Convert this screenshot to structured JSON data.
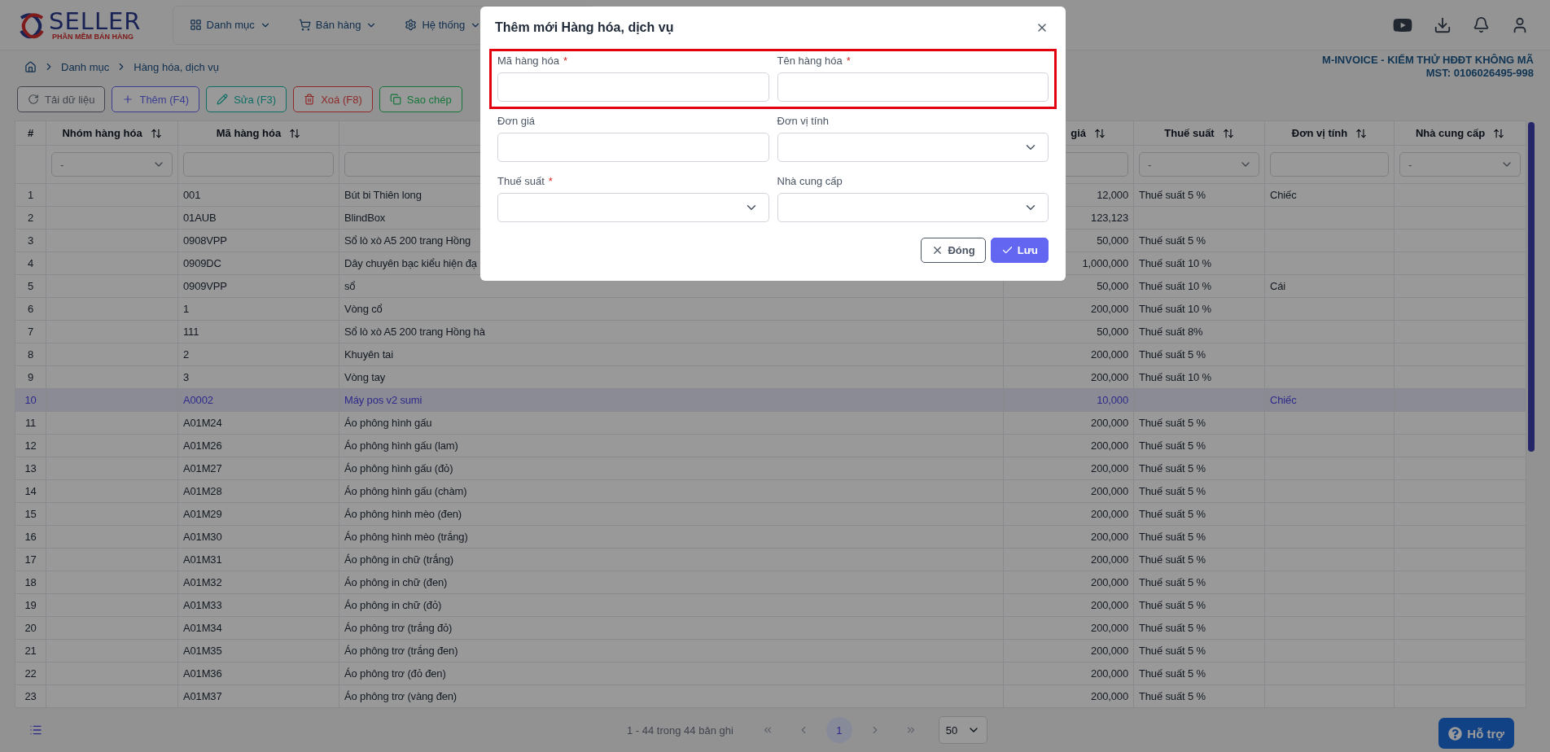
{
  "header": {
    "logo": {
      "title": "SELLER",
      "subtitle": "PHẦN MỀM BÁN HÀNG"
    },
    "nav": [
      {
        "label": "Danh mục",
        "kind": "catalog"
      },
      {
        "label": "Bán hàng",
        "kind": "sales"
      },
      {
        "label": "Hệ thống",
        "kind": "system"
      }
    ]
  },
  "breadcrumb": [
    "Danh mục",
    "Hàng hóa, dịch vụ"
  ],
  "company": [
    "M-INVOICE - KIỂM THỬ HĐĐT KHÔNG MÃ",
    "MST: 0106026495-998"
  ],
  "toolbar": [
    {
      "label": "Tải dữ liệu",
      "kind": "reload",
      "color": "#40444d"
    },
    {
      "label": "Thêm (F4)",
      "kind": "add",
      "color": "#3b3d91"
    },
    {
      "label": "Sửa (F3)",
      "kind": "edit",
      "color": "#0c6e64"
    },
    {
      "label": "Xoá (F8)",
      "kind": "delete",
      "color": "#8f2929"
    },
    {
      "label": "Sao chép",
      "kind": "copy",
      "color": "#147638"
    }
  ],
  "table": {
    "columns": [
      {
        "label": "#",
        "sortable": false,
        "kind": "index"
      },
      {
        "label": "Nhóm hàng hóa",
        "sortable": true,
        "kind": "text",
        "filter": {
          "kind": "select",
          "value": "-"
        }
      },
      {
        "label": "Mã hàng hóa",
        "sortable": true,
        "kind": "text",
        "filter": {
          "kind": "input"
        }
      },
      {
        "sortable": false,
        "kind": "text",
        "filter": {
          "kind": "input"
        }
      },
      {
        "label": "giá",
        "sortable": true,
        "kind": "number",
        "filter": {
          "kind": "input"
        }
      },
      {
        "label": "Thuế suất",
        "sortable": true,
        "kind": "text",
        "filter": {
          "kind": "select",
          "value": "-"
        }
      },
      {
        "label": "Đơn vị tính",
        "sortable": true,
        "kind": "text",
        "filter": {
          "kind": "input"
        }
      },
      {
        "label": "Nhà cung cấp",
        "sortable": true,
        "kind": "text",
        "filter": {
          "kind": "select",
          "value": "-"
        }
      }
    ],
    "rows": [
      {
        "no": "1",
        "code": "001",
        "name": "Bút bi Thiên long",
        "price": "12,000",
        "tax": "Thuế suất 5 %",
        "unit": "Chiếc",
        "selected": false
      },
      {
        "no": "2",
        "code": "01AUB",
        "name": "BlindBox",
        "price": "123,123",
        "selected": false
      },
      {
        "no": "3",
        "code": "0908VPP",
        "name": "Sổ lò xò A5 200 trang Hồng",
        "price": "50,000",
        "tax": "Thuế suất 5 %",
        "selected": false
      },
      {
        "no": "4",
        "code": "0909DC",
        "name": "Dây chuyên bạc kiểu hiện đạ",
        "price": "1,000,000",
        "tax": "Thuế suất 10 %",
        "selected": false
      },
      {
        "no": "5",
        "code": "0909VPP",
        "name": "sổ",
        "price": "50,000",
        "tax": "Thuế suất 10 %",
        "unit": "Cái",
        "selected": false
      },
      {
        "no": "6",
        "code": "1",
        "name": "Vòng cổ",
        "price": "200,000",
        "tax": "Thuế suất 10 %",
        "selected": false
      },
      {
        "no": "7",
        "code": "111",
        "name": "Sổ lò xò A5 200 trang Hồng hà",
        "price": "50,000",
        "tax": "Thuế suất 8%",
        "selected": false
      },
      {
        "no": "8",
        "code": "2",
        "name": "Khuyên tai",
        "price": "200,000",
        "tax": "Thuế suất 5 %",
        "selected": false
      },
      {
        "no": "9",
        "code": "3",
        "name": "Vòng tay",
        "price": "200,000",
        "tax": "Thuế suất 10 %",
        "selected": false
      },
      {
        "no": "10",
        "code": "A0002",
        "name": "Máy pos v2 sumi",
        "price": "10,000",
        "unit": "Chiếc",
        "selected": true
      },
      {
        "no": "11",
        "code": "A01M24",
        "name": "Áo phông hình gấu",
        "price": "200,000",
        "tax": "Thuế suất 5 %",
        "selected": false
      },
      {
        "no": "12",
        "code": "A01M26",
        "name": "Áo phông hình gấu (lam)",
        "price": "200,000",
        "tax": "Thuế suất 5 %",
        "selected": false
      },
      {
        "no": "13",
        "code": "A01M27",
        "name": "Áo phông hình gấu (đỏ)",
        "price": "200,000",
        "tax": "Thuế suất 5 %",
        "selected": false
      },
      {
        "no": "14",
        "code": "A01M28",
        "name": "Áo phông hình gấu (chàm)",
        "price": "200,000",
        "tax": "Thuế suất 5 %",
        "selected": false
      },
      {
        "no": "15",
        "code": "A01M29",
        "name": "Áo phông hình mèo (đen)",
        "price": "200,000",
        "tax": "Thuế suất 5 %",
        "selected": false
      },
      {
        "no": "16",
        "code": "A01M30",
        "name": "Áo phông hình mèo (trắng)",
        "price": "200,000",
        "tax": "Thuế suất 5 %",
        "selected": false
      },
      {
        "no": "17",
        "code": "A01M31",
        "name": "Áo phông in chữ (trắng)",
        "price": "200,000",
        "tax": "Thuế suất 5 %",
        "selected": false
      },
      {
        "no": "18",
        "code": "A01M32",
        "name": "Áo phông in chữ (đen)",
        "price": "200,000",
        "tax": "Thuế suất 5 %",
        "selected": false
      },
      {
        "no": "19",
        "code": "A01M33",
        "name": "Áo phông in chữ (đỏ)",
        "price": "200,000",
        "tax": "Thuế suất 5 %",
        "selected": false
      },
      {
        "no": "20",
        "code": "A01M34",
        "name": "Áo phông trơ (trắng đỏ)",
        "price": "200,000",
        "tax": "Thuế suất 5 %",
        "selected": false
      },
      {
        "no": "21",
        "code": "A01M35",
        "name": "Áo phông trơ (trắng đen)",
        "price": "200,000",
        "tax": "Thuế suất 5 %",
        "selected": false
      },
      {
        "no": "22",
        "code": "A01M36",
        "name": "Áo phông trơ (đỏ đen)",
        "price": "200,000",
        "tax": "Thuế suất 5 %",
        "selected": false
      },
      {
        "no": "23",
        "code": "A01M37",
        "name": "Áo phông trơ (vàng đen)",
        "price": "200,000",
        "tax": "Thuế suất 5 %",
        "selected": false
      }
    ]
  },
  "pagination": {
    "summary": "1 - 44 trong 44 bản ghi",
    "pages": [
      {
        "label": "1",
        "selected": true
      }
    ],
    "page_size": "50"
  },
  "help": {
    "label": "Hỗ trợ"
  },
  "modal": {
    "title": "Thêm mới Hàng hóa, dịch vụ",
    "rows": [
      {
        "highlighted": true,
        "fields": [
          {
            "label": "Mã hàng hóa",
            "required_mark": "*",
            "kind": "input"
          },
          {
            "label": "Tên hàng hóa",
            "required_mark": "*",
            "kind": "input"
          }
        ]
      },
      {
        "highlighted": false,
        "fields": [
          {
            "label": "Đơn giá",
            "kind": "input"
          },
          {
            "label": "Đơn vị tính",
            "kind": "select"
          }
        ]
      },
      {
        "highlighted": false,
        "fields": [
          {
            "label": "Thuế suất",
            "required_mark": "*",
            "kind": "select"
          },
          {
            "label": "Nhà cung cấp",
            "kind": "select"
          }
        ]
      }
    ],
    "buttons": [
      {
        "label": "Đóng",
        "kind": "secondary"
      },
      {
        "label": "Lưu",
        "kind": "primary"
      }
    ]
  }
}
